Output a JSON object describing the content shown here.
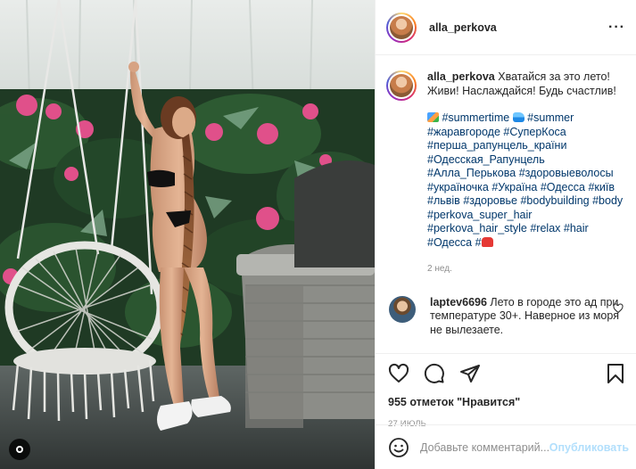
{
  "post": {
    "author": "alla_perkova",
    "more_icon": "ellipsis-icon"
  },
  "caption": {
    "author": "alla_perkova",
    "text": "Хватайся за это лето! Живи! Наслаждайся! Будь счастлив!",
    "tags_line": [
      {
        "type": "emoji",
        "name": "camera-emoji"
      },
      {
        "type": "tag",
        "text": "#summertime"
      },
      {
        "type": "emoji",
        "name": "wave-emoji"
      },
      {
        "type": "tag",
        "text": "#summer"
      },
      {
        "type": "tag",
        "text": "#жаравгороде"
      },
      {
        "type": "tag",
        "text": "#СуперКоса"
      },
      {
        "type": "tag",
        "text": "#перша_рапунцель_країни"
      },
      {
        "type": "tag",
        "text": "#Одесская_Рапунцель"
      },
      {
        "type": "tag",
        "text": "#Алла_Перькова"
      },
      {
        "type": "tag",
        "text": "#здоровыеволосы"
      },
      {
        "type": "tag",
        "text": "#украïночка"
      },
      {
        "type": "tag",
        "text": "#Україна"
      },
      {
        "type": "tag",
        "text": "#Одесса"
      },
      {
        "type": "tag",
        "text": "#київ"
      },
      {
        "type": "tag",
        "text": "#львів"
      },
      {
        "type": "tag",
        "text": "#здоровье"
      },
      {
        "type": "tag",
        "text": "#bodybuilding"
      },
      {
        "type": "tag",
        "text": "#body"
      },
      {
        "type": "tag",
        "text": "#perkova_super_hair"
      },
      {
        "type": "tag",
        "text": "#perkova_hair_style"
      },
      {
        "type": "tag",
        "text": "#relax"
      },
      {
        "type": "tag",
        "text": "#hair"
      },
      {
        "type": "tag",
        "text": "#Одесса"
      },
      {
        "type": "tag",
        "text": "#"
      },
      {
        "type": "emoji",
        "name": "swimsuit-emoji"
      }
    ],
    "time": "2 нед."
  },
  "comment": {
    "author": "laptev6696",
    "text": "Лето в городе это ад при температуре 30+. Наверное из моря не вылезаете."
  },
  "actions": {
    "like_icon": "heart-icon",
    "comment_icon": "comment-icon",
    "share_icon": "share-icon",
    "save_icon": "bookmark-icon",
    "likes": "955 отметок \"Нравится\"",
    "date": "27 ИЮЛЬ"
  },
  "add_comment": {
    "placeholder": "Добавьте комментарий...",
    "publish": "Опубликовать"
  },
  "colors": {
    "link": "#00376b",
    "muted": "#8e8e8e",
    "publish_disabled": "#b2dffc"
  }
}
